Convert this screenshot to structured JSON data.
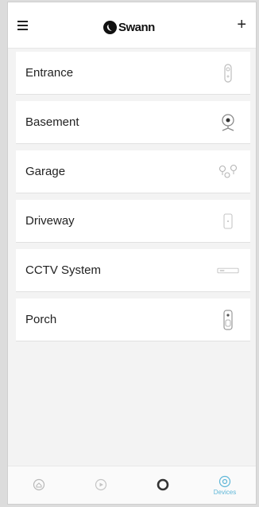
{
  "header": {
    "brand": "Swann",
    "menu_icon": "hamburger-menu-icon",
    "add_label": "+"
  },
  "devices": [
    {
      "label": "Entrance",
      "icon": "doorbell-camera-icon"
    },
    {
      "label": "Basement",
      "icon": "dome-camera-icon"
    },
    {
      "label": "Garage",
      "icon": "multi-camera-icon"
    },
    {
      "label": "Driveway",
      "icon": "bullet-camera-icon"
    },
    {
      "label": "CCTV System",
      "icon": "dvr-recorder-icon"
    },
    {
      "label": "Porch",
      "icon": "video-doorbell-icon"
    }
  ],
  "tabs": [
    {
      "icon": "home-icon",
      "label": ""
    },
    {
      "icon": "playback-icon",
      "label": ""
    },
    {
      "icon": "record-icon",
      "label": ""
    },
    {
      "icon": "devices-icon",
      "label": "Devices",
      "active": true
    }
  ],
  "colors": {
    "accent": "#5fb7d8",
    "brand": "#111111",
    "row_background": "#ffffff",
    "page_background": "#f3f3f3"
  }
}
